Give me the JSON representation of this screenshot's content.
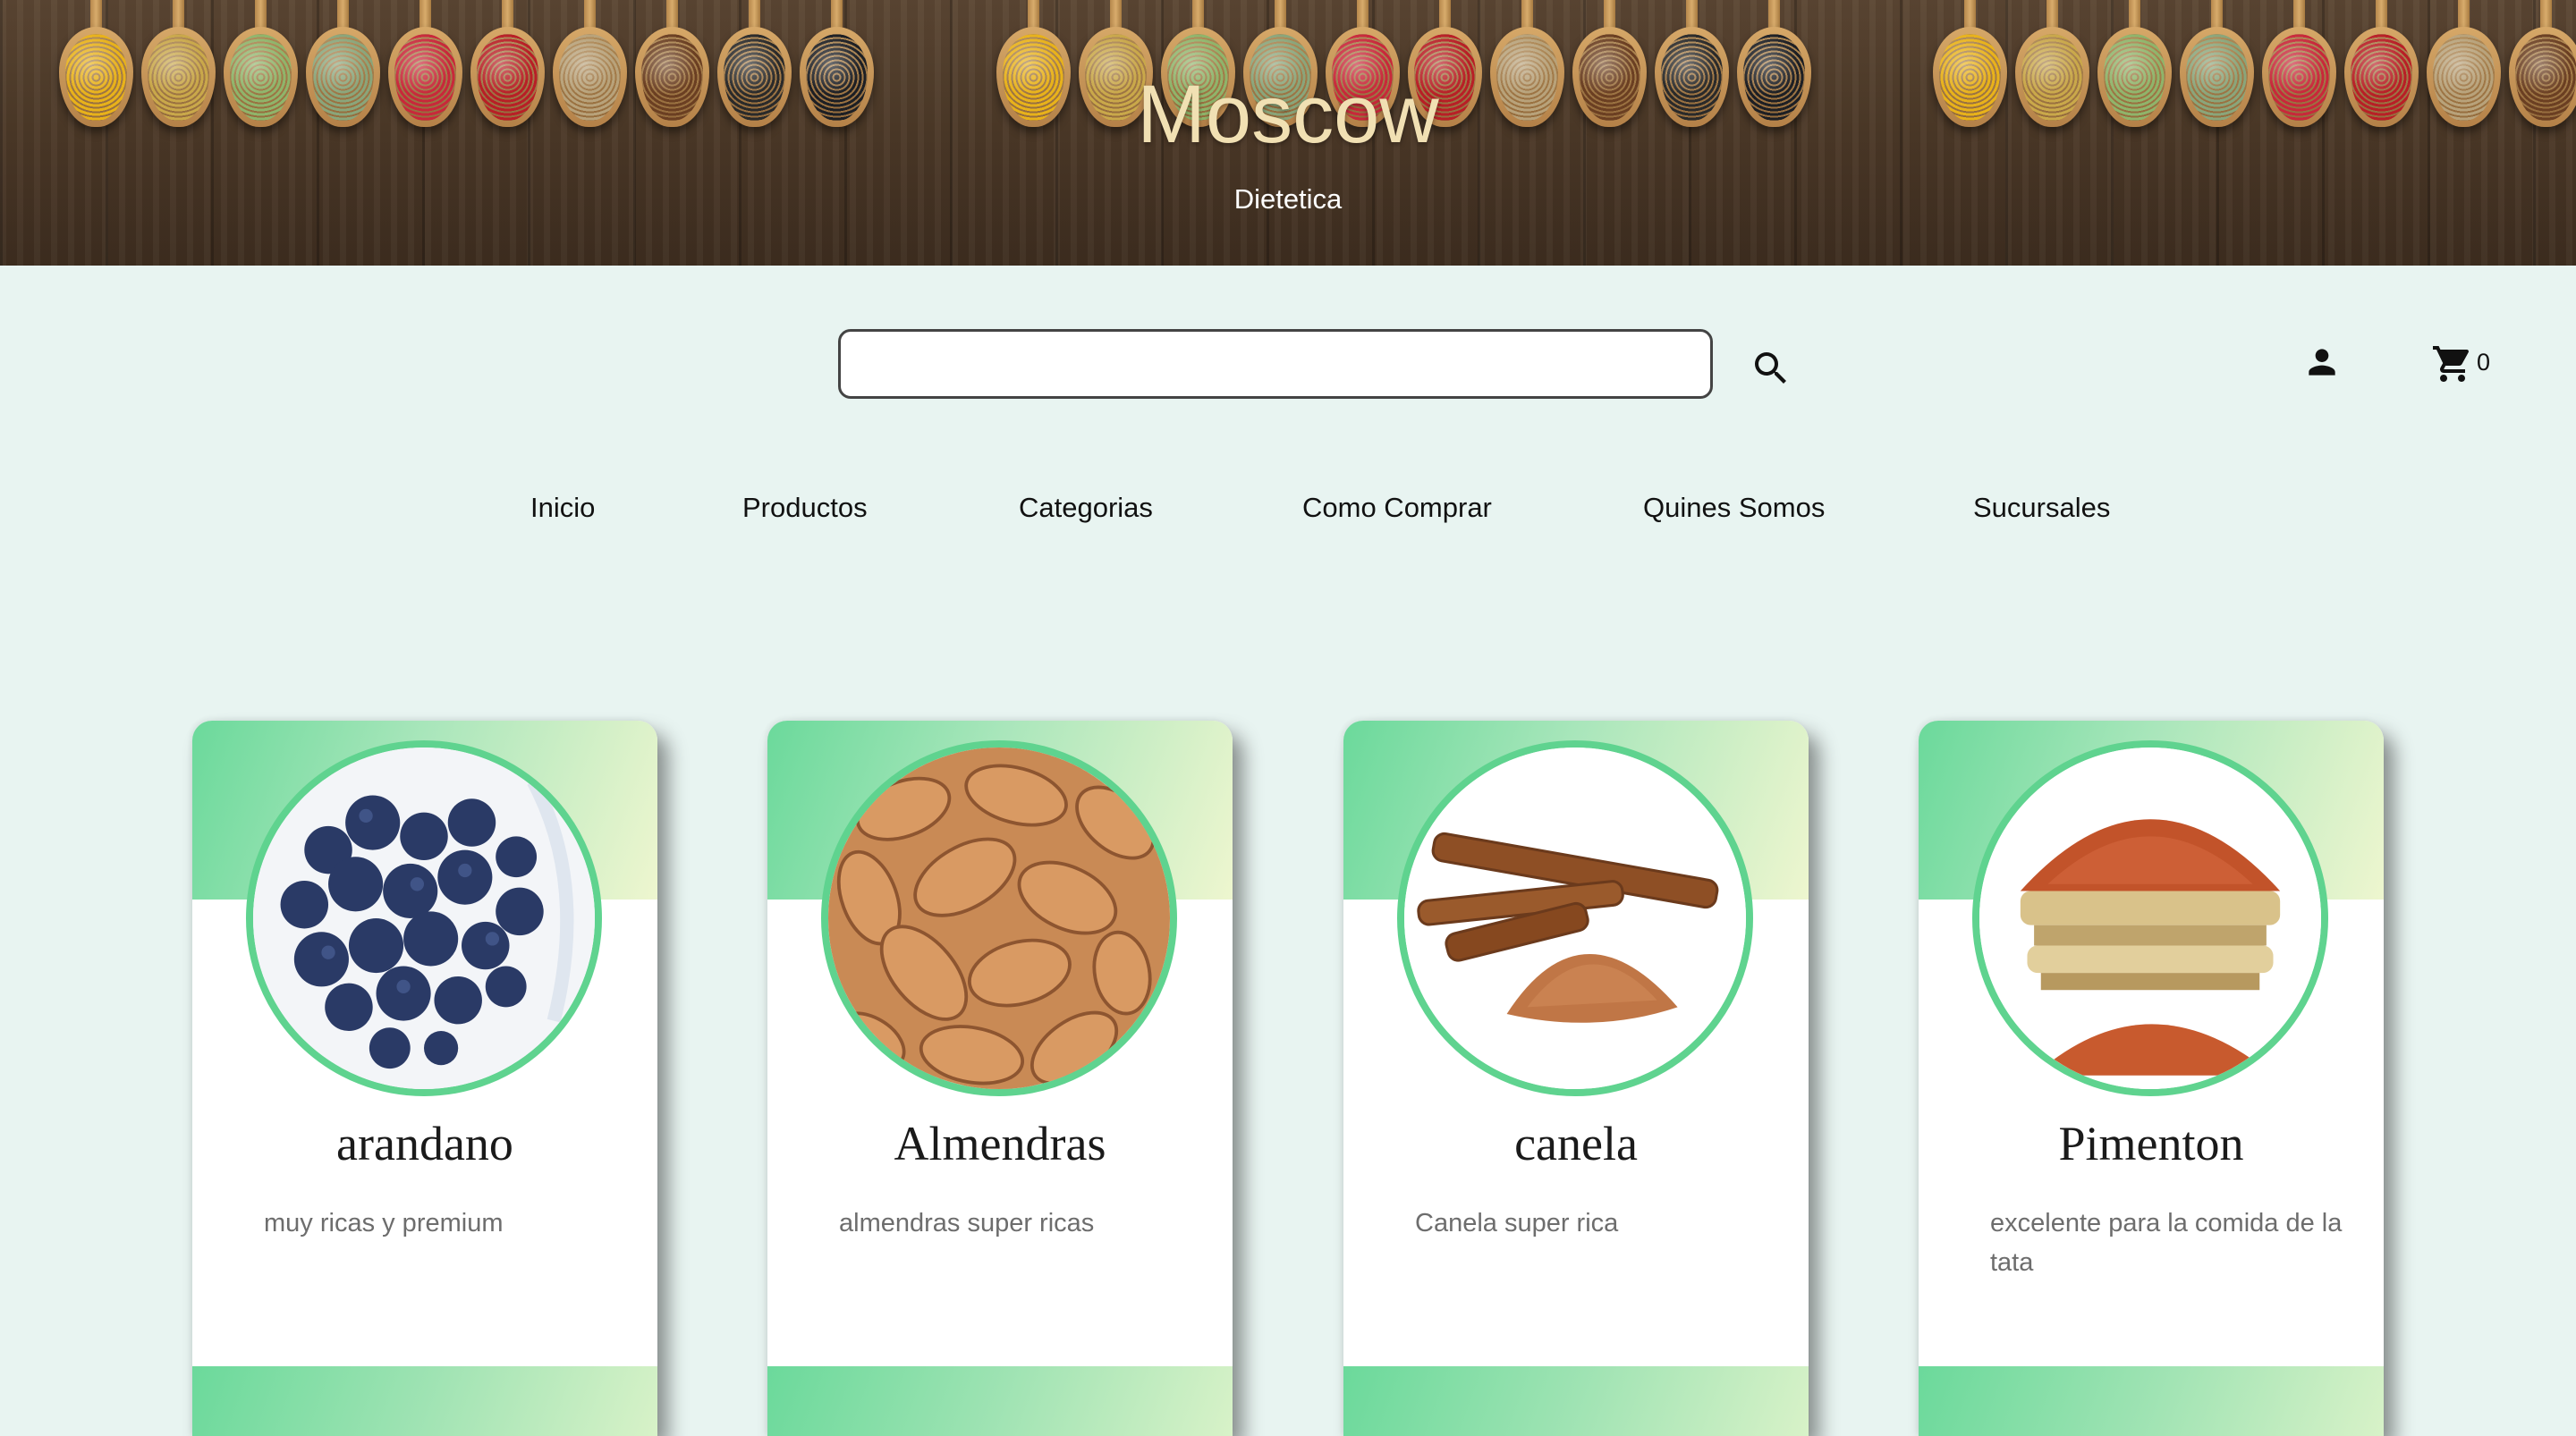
{
  "banner": {
    "title": "Moscow",
    "subtitle": "Dietetica",
    "spice_colors": [
      "#e8b21a",
      "#c9a84a",
      "#8fb46a",
      "#8aa57a",
      "#c8283a",
      "#b81f26",
      "#b8a27a",
      "#6b3f22",
      "#2a2a2a",
      "#1d1f24"
    ]
  },
  "search": {
    "value": "",
    "placeholder": ""
  },
  "header_icons": {
    "search": "search-icon",
    "user": "user-icon",
    "cart": "cart-icon"
  },
  "cart": {
    "count": "0"
  },
  "nav": {
    "items": [
      {
        "label": "Inicio"
      },
      {
        "label": "Productos"
      },
      {
        "label": "Categorias"
      },
      {
        "label": "Como Comprar"
      },
      {
        "label": "Quines Somos"
      },
      {
        "label": "Sucursales"
      }
    ]
  },
  "products": [
    {
      "name": "arandano",
      "description": "muy ricas y premium"
    },
    {
      "name": "Almendras",
      "description": "almendras super ricas"
    },
    {
      "name": "canela",
      "description": "Canela super rica"
    },
    {
      "name": "Pimenton",
      "description": "excelente para la comida de la tata"
    }
  ],
  "colors": {
    "page_background": "#e8f4f1",
    "accent_green": "#5fd38f",
    "banner_title": "#f1e0b3"
  }
}
